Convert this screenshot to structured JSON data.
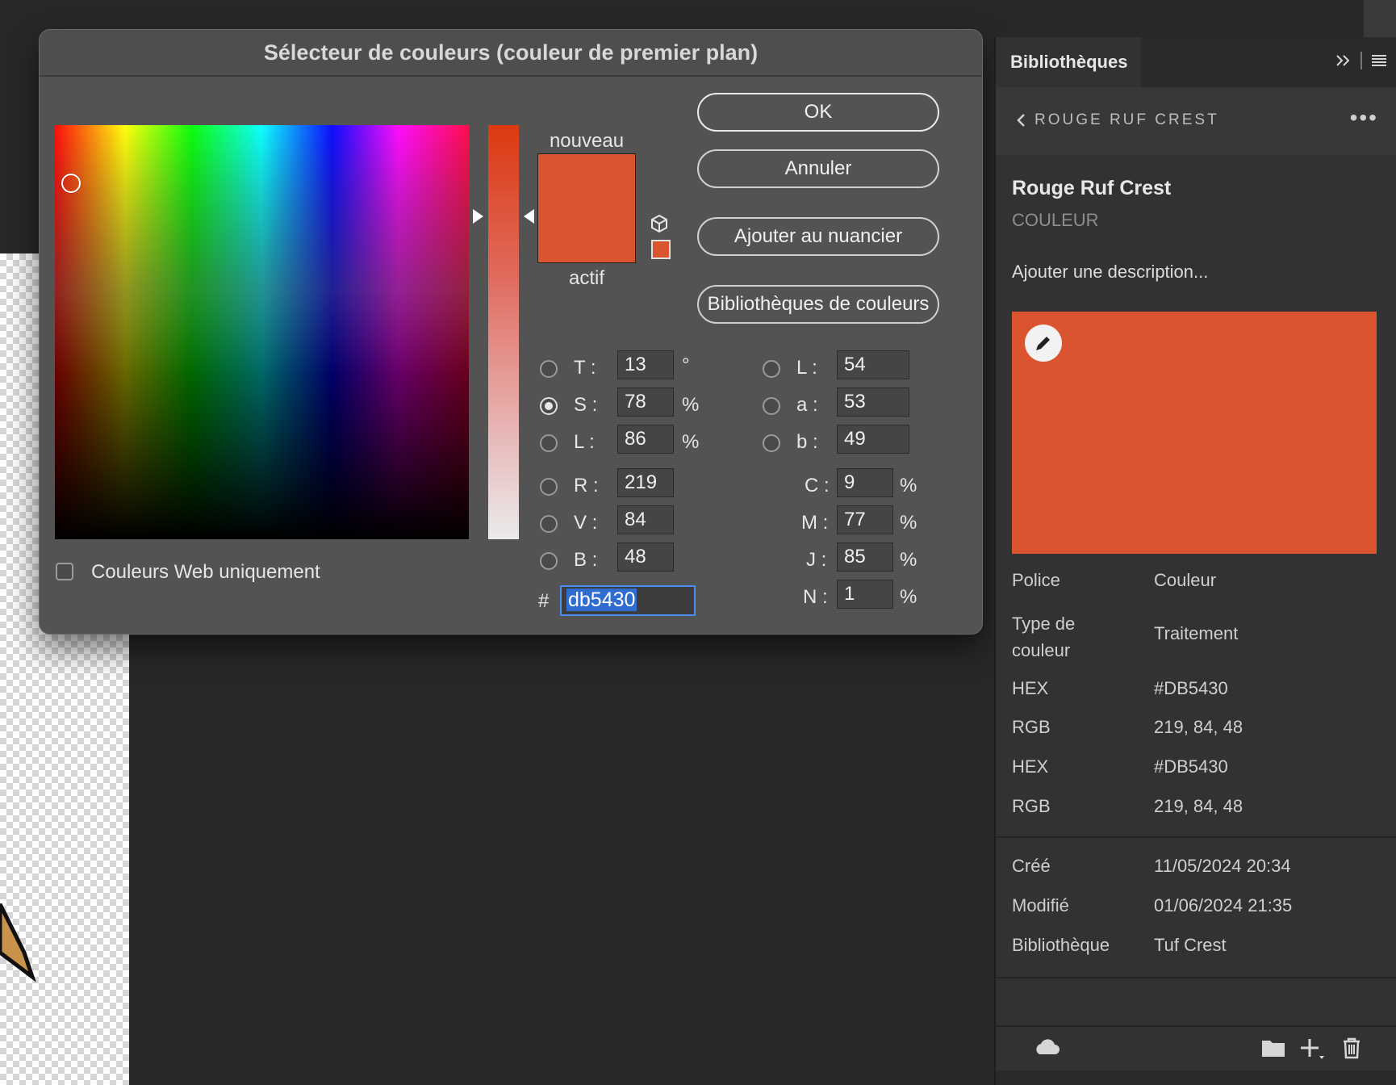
{
  "dialog": {
    "title": "Sélecteur de couleurs (couleur de premier plan)",
    "new_label": "nouveau",
    "active_label": "actif",
    "new_color": "#db5430",
    "active_color": "#db5430",
    "buttons": {
      "ok": "OK",
      "cancel": "Annuler",
      "add_swatch": "Ajouter au nuancier",
      "color_libraries": "Bibliothèques de couleurs"
    },
    "hsb": {
      "h_label": "T :",
      "h_value": "13",
      "h_unit": "°",
      "s_label": "S :",
      "s_value": "78",
      "s_unit": "%",
      "b_label": "L :",
      "b_value": "86",
      "b_unit": "%"
    },
    "rgb": {
      "r_label": "R :",
      "r_value": "219",
      "g_label": "V :",
      "g_value": "84",
      "b_label": "B :",
      "b_value": "48"
    },
    "lab": {
      "l_label": "L :",
      "l_value": "54",
      "a_label": "a :",
      "a_value": "53",
      "b_label": "b :",
      "b_value": "49"
    },
    "cmyk": {
      "c_label": "C :",
      "c_value": "9",
      "c_unit": "%",
      "m_label": "M :",
      "m_value": "77",
      "m_unit": "%",
      "y_label": "J :",
      "y_value": "85",
      "y_unit": "%",
      "k_label": "N :",
      "k_value": "1",
      "k_unit": "%"
    },
    "hex_prefix": "#",
    "hex_value": "db5430",
    "web_only_label": "Couleurs Web uniquement"
  },
  "panel": {
    "tab": "Bibliothèques",
    "breadcrumb": "ROUGE RUF CREST",
    "item_name": "Rouge Ruf Crest",
    "item_type": "COULEUR",
    "description_placeholder": "Ajouter une description...",
    "swatch_color": "#DB5430",
    "properties": [
      {
        "label": "Police",
        "value": "Couleur"
      },
      {
        "label": "Type de couleur",
        "value": "Traitement"
      },
      {
        "label": "HEX",
        "value": "#DB5430"
      },
      {
        "label": "RGB",
        "value": "219, 84, 48"
      },
      {
        "label": "HEX",
        "value": "#DB5430"
      },
      {
        "label": "RGB",
        "value": "219, 84, 48"
      }
    ],
    "meta": [
      {
        "label": "Créé",
        "value": "11/05/2024 20:34"
      },
      {
        "label": "Modifié",
        "value": "01/06/2024 21:35"
      },
      {
        "label": "Bibliothèque",
        "value": "Tuf Crest"
      }
    ]
  }
}
